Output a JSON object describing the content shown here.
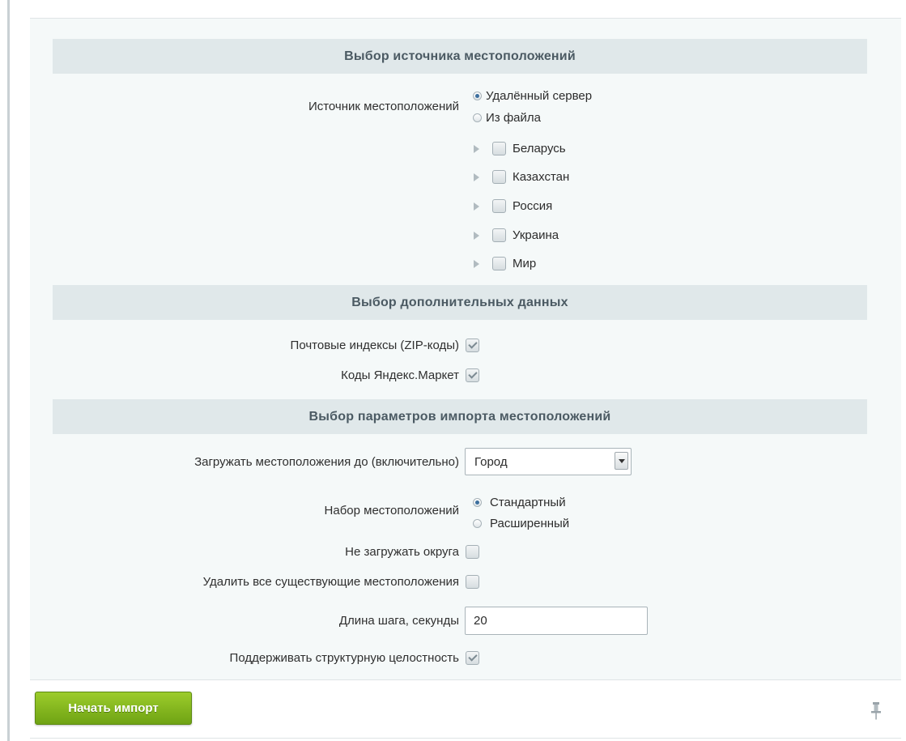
{
  "sections": {
    "source": {
      "title": "Выбор источника местоположений"
    },
    "extra": {
      "title": "Выбор дополнительных данных"
    },
    "params": {
      "title": "Выбор параметров импорта местоположений"
    }
  },
  "source_field": {
    "label": "Источник местоположений",
    "options": [
      {
        "label": "Удалённый сервер",
        "selected": true
      },
      {
        "label": "Из файла",
        "selected": false
      }
    ]
  },
  "countries": [
    {
      "label": "Беларусь",
      "checked": false
    },
    {
      "label": "Казахстан",
      "checked": false
    },
    {
      "label": "Россия",
      "checked": false
    },
    {
      "label": "Украина",
      "checked": false
    },
    {
      "label": "Мир",
      "checked": false
    }
  ],
  "extra_fields": [
    {
      "label": "Почтовые индексы (ZIP-коды)",
      "checked": true
    },
    {
      "label": "Коды Яндекс.Маркет",
      "checked": true
    }
  ],
  "params_fields": {
    "load_until": {
      "label": "Загружать местоположения до (включительно)",
      "value": "Город"
    },
    "set": {
      "label": "Набор местоположений",
      "options": [
        {
          "label": "Стандартный",
          "selected": true
        },
        {
          "label": "Расширенный",
          "selected": false
        }
      ]
    },
    "no_districts": {
      "label": "Не загружать округа",
      "checked": false
    },
    "delete_existing": {
      "label": "Удалить все существующие местоположения",
      "checked": false
    },
    "step_length": {
      "label": "Длина шага, секунды",
      "value": "20"
    },
    "integrity": {
      "label": "Поддерживать структурную целостность",
      "checked": true
    }
  },
  "start_button": {
    "label": "Начать импорт"
  },
  "icons": {
    "pin": "pin-icon",
    "expand": "expand-arrow-icon"
  },
  "colors": {
    "accent_button": "#7fb51c",
    "section_header_bg": "#e0e8ea",
    "panel_bg": "#f5f9f9"
  }
}
